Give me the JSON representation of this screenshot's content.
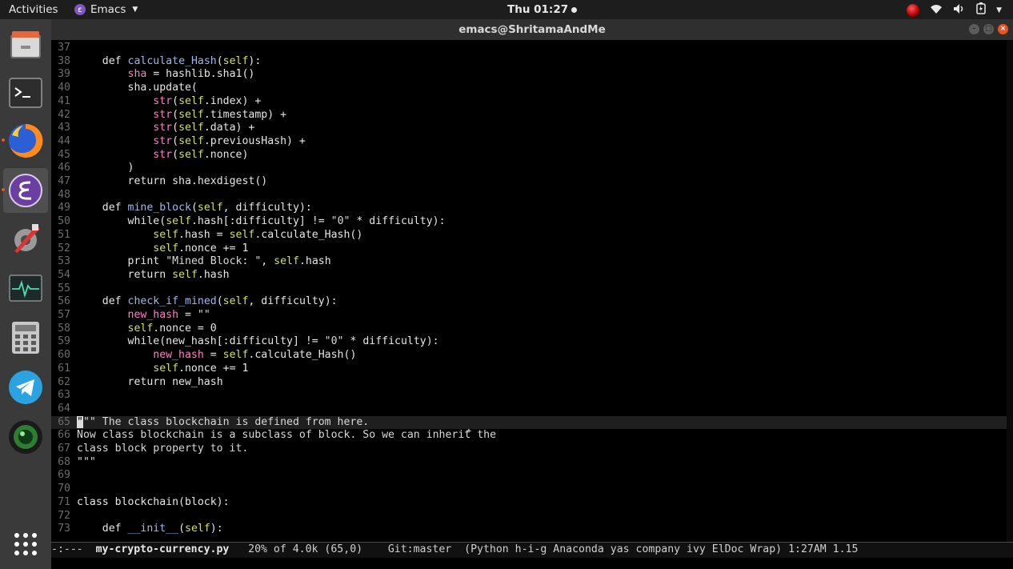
{
  "topbar": {
    "activities": "Activities",
    "app_name": "Emacs",
    "clock": "Thu 01:27"
  },
  "window": {
    "title": "emacs@ShritamaAndMe"
  },
  "dock": {
    "items": [
      "files-icon",
      "terminal-icon",
      "firefox-icon",
      "emacs-icon",
      "settings-icon",
      "system-monitor-icon",
      "calculator-icon",
      "telegram-icon",
      "camera-icon",
      "app-grid-icon"
    ]
  },
  "editor": {
    "lines": [
      {
        "n": "37",
        "text": ""
      },
      {
        "n": "38",
        "text": "    def calculate_Hash(self):"
      },
      {
        "n": "39",
        "text": "        sha = hashlib.sha1()"
      },
      {
        "n": "40",
        "text": "        sha.update("
      },
      {
        "n": "41",
        "text": "            str(self.index) +"
      },
      {
        "n": "42",
        "text": "            str(self.timestamp) +"
      },
      {
        "n": "43",
        "text": "            str(self.data) +"
      },
      {
        "n": "44",
        "text": "            str(self.previousHash) +"
      },
      {
        "n": "45",
        "text": "            str(self.nonce)"
      },
      {
        "n": "46",
        "text": "        )"
      },
      {
        "n": "47",
        "text": "        return sha.hexdigest()"
      },
      {
        "n": "48",
        "text": ""
      },
      {
        "n": "49",
        "text": "    def mine_block(self, difficulty):"
      },
      {
        "n": "50",
        "text": "        while(self.hash[:difficulty] != \"0\" * difficulty):"
      },
      {
        "n": "51",
        "text": "            self.hash = self.calculate_Hash()"
      },
      {
        "n": "52",
        "text": "            self.nonce += 1"
      },
      {
        "n": "53",
        "text": "        print \"Mined Block: \", self.hash"
      },
      {
        "n": "54",
        "text": "        return self.hash"
      },
      {
        "n": "55",
        "text": ""
      },
      {
        "n": "56",
        "text": "    def check_if_mined(self, difficulty):"
      },
      {
        "n": "57",
        "text": "        new_hash = \"\""
      },
      {
        "n": "58",
        "text": "        self.nonce = 0"
      },
      {
        "n": "59",
        "text": "        while(new_hash[:difficulty] != \"0\" * difficulty):"
      },
      {
        "n": "60",
        "text": "            new_hash = self.calculate_Hash()"
      },
      {
        "n": "61",
        "text": "            self.nonce += 1"
      },
      {
        "n": "62",
        "text": "        return new_hash"
      },
      {
        "n": "63",
        "text": ""
      },
      {
        "n": "64",
        "text": ""
      },
      {
        "n": "65",
        "text": "\"\"\" The class blockchain is defined from here."
      },
      {
        "n": "66",
        "text": "Now class blockchain is a subclass of block. So we can inherit the"
      },
      {
        "n": "67",
        "text": "class block property to it."
      },
      {
        "n": "68",
        "text": "\"\"\""
      },
      {
        "n": "69",
        "text": ""
      },
      {
        "n": "70",
        "text": ""
      },
      {
        "n": "71",
        "text": "class blockchain(block):"
      },
      {
        "n": "72",
        "text": ""
      },
      {
        "n": "73",
        "text": "    def __init__(self):"
      }
    ]
  },
  "modeline": {
    "status": "-:---",
    "buffer": "my-crypto-currency.py",
    "position": "20% of 4.0k (65,0)",
    "vc": "Git:master",
    "modes": "(Python h-i-g Anaconda yas company ivy ElDoc Wrap)",
    "time": "1:27AM",
    "load": "1.15"
  },
  "colors": {
    "keyword": "#e6e6e6",
    "function": "#9cb8f0",
    "variable": "#ff7fc8",
    "self": "#d2e05a",
    "current_line": "#1f1f1f",
    "accent": "#e95420"
  }
}
